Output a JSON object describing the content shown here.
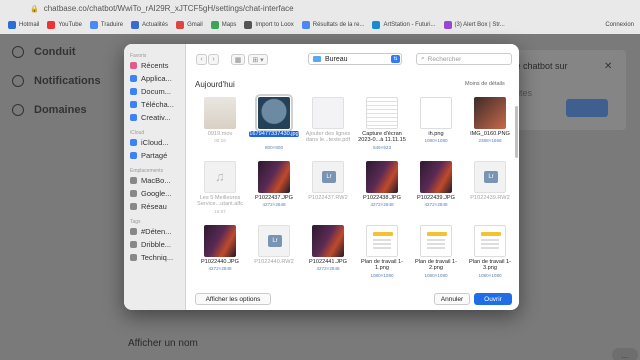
{
  "browser": {
    "url": "chatbase.co/chatbot/WwiTo_rAI29R_xJTCF5gH/settings/chat-interface",
    "bookmarks": [
      {
        "label": "Hotmail",
        "color": "#2a6ed8"
      },
      {
        "label": "YouTube",
        "color": "#e33"
      },
      {
        "label": "Traduire",
        "color": "#4a8af0"
      },
      {
        "label": "Actualités",
        "color": "#3a6bd3"
      },
      {
        "label": "Gmail",
        "color": "#d44"
      },
      {
        "label": "Maps",
        "color": "#3aa65a"
      },
      {
        "label": "Import to Loox",
        "color": "#555"
      },
      {
        "label": "Résultats de la re...",
        "color": "#4a8af0"
      },
      {
        "label": "ArtStation - Futuri...",
        "color": "#1a8ad0"
      },
      {
        "label": "(3) Alert Box | Str...",
        "color": "#9a46d0"
      }
    ],
    "bookmarks_right": "Connexion"
  },
  "page": {
    "nav": [
      "Conduit",
      "Notifications",
      "Domaines"
    ],
    "card_title": "tre chatbot sur",
    "card_sub": "ites",
    "afficher_label": "Afficher un nom",
    "zoom": "..."
  },
  "dialog": {
    "sidebar": {
      "favoris_label": "Favoris",
      "favoris": [
        {
          "label": "Récents",
          "color": "#e05b8a"
        },
        {
          "label": "Applica...",
          "color": "#3b82f6"
        },
        {
          "label": "Docum...",
          "color": "#3b82f6"
        },
        {
          "label": "Téléchа...",
          "color": "#3b82f6"
        },
        {
          "label": "Creativ...",
          "color": "#3b82f6"
        }
      ],
      "icloud_label": "iCloud",
      "icloud": [
        {
          "label": "iCloud...",
          "color": "#3b82f6"
        },
        {
          "label": "Partagé",
          "color": "#3b82f6"
        }
      ],
      "emplacements_label": "Emplacements",
      "emplacements": [
        {
          "label": "MacBo...",
          "color": "#888"
        },
        {
          "label": "Google...",
          "color": "#888"
        },
        {
          "label": "Réseau",
          "color": "#888"
        }
      ],
      "tags_label": "Tags",
      "tags": [
        {
          "label": "#Déten...",
          "color": "#888"
        },
        {
          "label": "Dribble...",
          "color": "#888"
        },
        {
          "label": "Techniq...",
          "color": "#888"
        }
      ]
    },
    "toolbar": {
      "back": "‹",
      "forward": "›",
      "view_grid": "▦",
      "view_options": "⊞ ▾",
      "location": "Bureau",
      "search_placeholder": "Rechercher"
    },
    "section_title": "Aujourd'hui",
    "less_details": "Moins de détails",
    "files": [
      {
        "name": "0919.mov",
        "meta": "00:16",
        "kind": "movie",
        "dim": true
      },
      {
        "name": "1679477337430.jpg",
        "meta": "800×800",
        "kind": "avatar",
        "dim": false,
        "selected": true
      },
      {
        "name": "Ajouter des lignes dans le...texte.pdf",
        "meta": "",
        "kind": "doc",
        "dim": true
      },
      {
        "name": "Capture d'écran 2023-0...à 11.11.15",
        "meta": "546×523",
        "kind": "sheet",
        "dim": false
      },
      {
        "name": "ih.png",
        "meta": "1080×1080",
        "kind": "png",
        "dim": false
      },
      {
        "name": "IMG_0160.PNG",
        "meta": "2388×1668",
        "kind": "img",
        "dim": false
      },
      {
        "name": "Les 5 Meilleures Service...utant.alfc",
        "meta": "16:07",
        "kind": "alf",
        "dim": true
      },
      {
        "name": "P1022437.JPG",
        "meta": "4272×2848",
        "kind": "photo",
        "dim": false
      },
      {
        "name": "P1022437.RW2",
        "meta": "",
        "kind": "raw",
        "dim": true
      },
      {
        "name": "P1022438.JPG",
        "meta": "4272×2848",
        "kind": "photo",
        "dim": false
      },
      {
        "name": "P1022439.JPG",
        "meta": "4272×2848",
        "kind": "photo",
        "dim": false
      },
      {
        "name": "P1022439.RW2",
        "meta": "",
        "kind": "raw",
        "dim": true
      },
      {
        "name": "P1022440.JPG",
        "meta": "4272×2848",
        "kind": "photo",
        "dim": false
      },
      {
        "name": "P1022440.RW2",
        "meta": "",
        "kind": "raw",
        "dim": true
      },
      {
        "name": "P1022441.JPG",
        "meta": "4272×2848",
        "kind": "photo",
        "dim": false
      },
      {
        "name": "Plan de travail 1-1.png",
        "meta": "1080×1080",
        "kind": "plan",
        "dim": false
      },
      {
        "name": "Plan de travail 1-2.png",
        "meta": "1080×1080",
        "kind": "plan",
        "dim": false
      },
      {
        "name": "Plan de travail 1-3.png",
        "meta": "1080×1080",
        "kind": "plan",
        "dim": false
      }
    ],
    "footer": {
      "options": "Afficher les options",
      "cancel": "Annuler",
      "open": "Ouvrir"
    }
  }
}
